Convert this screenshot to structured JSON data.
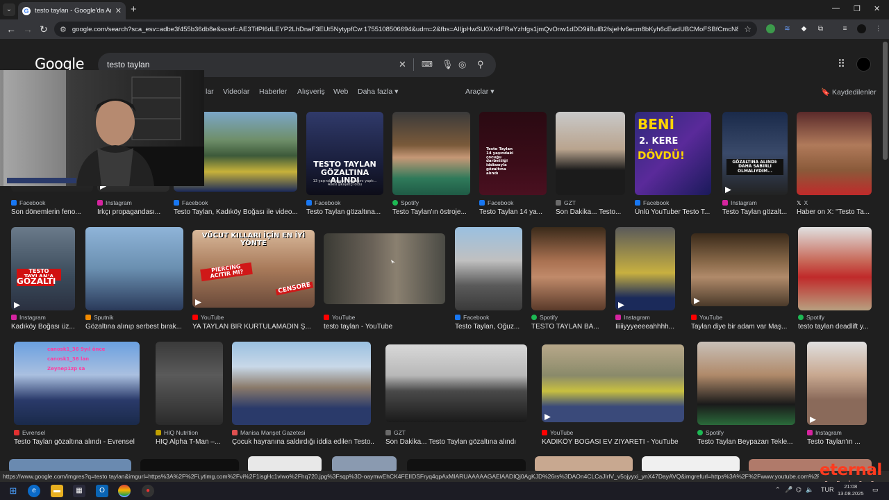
{
  "browser": {
    "tab_title": "testo taylan - Google'da Ara",
    "url": "google.com/search?sca_esv=adbe3f455b36db8e&sxsrf=AE3TifPl6dLEYP2LhDnaF3EUt5NytypfCw:1755108506694&udm=2&fbs=AIIjpHwSU0Xn4FRaYzhfgs1jmQvOnw1dDD9iiBulB2fsjeHv6ecm8bKyh6cEwdUBCMoFSBfCmcN8r0zRavg..."
  },
  "google": {
    "logo": "Google",
    "query": "testo taylan",
    "filters": {
      "partial": "lar",
      "videos": "Videolar",
      "news": "Haberler",
      "shopping": "Alışveriş",
      "web": "Web",
      "more": "Daha fazla",
      "tools": "Araçlar"
    },
    "saved": "Kaydedilenler"
  },
  "results": {
    "row1": [
      {
        "source": "Facebook",
        "caption": "Son dönemlerin feno..."
      },
      {
        "source": "Instagram",
        "caption": "Irkçı propagandası..."
      },
      {
        "source": "Facebook",
        "caption": "Testo Taylan, Kadıköy Boğası ile video..."
      },
      {
        "source": "Facebook",
        "caption": "Testo Taylan gözaltına..."
      },
      {
        "source": "Spotify",
        "caption": "Testo Taylan'ın östroje..."
      },
      {
        "source": "Facebook",
        "caption": "Testo Taylan 14 ya..."
      },
      {
        "source": "GZT",
        "caption": "Son Dakika... Testo..."
      },
      {
        "source": "Facebook",
        "caption": "Ünlü YouTuber Testo T..."
      },
      {
        "source": "Instagram",
        "caption": "Testo Taylan gözalt..."
      },
      {
        "source": "X",
        "caption": "Haber on X: \"Testo Ta..."
      }
    ],
    "row2": [
      {
        "source": "Instagram",
        "caption": "Kadıköy Boğası üz..."
      },
      {
        "source": "Sputnik",
        "caption": "Gözaltına alınıp serbest bırak..."
      },
      {
        "source": "YouTube",
        "caption": "YA TAYLAN BİR KURTULAMADIN Ş..."
      },
      {
        "source": "YouTube",
        "caption": "testo taylan - YouTube"
      },
      {
        "source": "Facebook",
        "caption": "Testo Taylan, Oğuz..."
      },
      {
        "source": "Spotify",
        "caption": "TESTO TAYLAN BA..."
      },
      {
        "source": "Instagram",
        "caption": "İiiiiyyyeeeeahhhh..."
      },
      {
        "source": "YouTube",
        "caption": "Taylan diye bir adam var Maş..."
      },
      {
        "source": "Spotify",
        "caption": "testo taylan deadlift y..."
      }
    ],
    "row3": [
      {
        "source": "Evrensel",
        "caption": "Testo Taylan gözaltına alındı - Evrensel"
      },
      {
        "source": "HIQ Nutrition",
        "caption": "HIQ Alpha T-Man –..."
      },
      {
        "source": "Manisa Manşet Gazetesi",
        "caption": "Çocuk hayranına saldırdığı iddia edilen Testo..."
      },
      {
        "source": "GZT",
        "caption": "Son Dakika... Testo Taylan gözaltına alındı"
      },
      {
        "source": "YouTube",
        "caption": "KADIKÖY BOĞASI EV ZİYARETİ - YouTube"
      },
      {
        "source": "Spotify",
        "caption": "Testo Taylan Beypazarı Tekle..."
      },
      {
        "source": "Instagram",
        "caption": "Testo Taylan'ın ..."
      }
    ]
  },
  "thumb_text": {
    "gozaltina": "TESTO TAYLAN GÖZALTINA ALINDI",
    "gozaltina_sub": "13 yaşındaki çocuk hayranını yaptı... Ailesi şikayetçi oldu",
    "beni": "BENİ",
    "kere": "2. KERE",
    "dovdu": "DÖVDÜ!",
    "testo14": "Testo Taylan 14 yaşındaki çocuğu darbettiği iddiasıyla gözaltına alındı",
    "sabirli": "GÖZALTINA ALINDI: DAHA SABIRLI OLMALIYDIM...",
    "ozalti_a": "TESTO TAYLAN'A",
    "ozalti_b": "GÖZALTI",
    "vucut": "VÜCUT KILLARI İÇİN EN İYİ YÖNTE",
    "piercing": "PIERCING ACITIR MI?",
    "censored": "CENSORE",
    "comments": [
      "canosk1_36 9yıl önce",
      "canosk1_36 lan",
      "Zeynep1zp sa"
    ]
  },
  "statusbar": {
    "url": "https://www.google.com/imgres?q=testo taylan&imgurl=https%3A%2F%2Fi.ytimg.com%2Fvi%2F1isgHc1viwo%2Fhq720.jpg%3Fsqp%3D-oaymwEhCK4FEIIDSFryq4qpAxMIARUAAAAAGAElAADIQj0AgKJD%26rs%3DAOn4CLCaJIrlV_v5ojyyxi_ynX47DayAVQ&imgrefurl=https%3A%2F%2Fwww.youtube.com%2F%40testotaylan&docid=OnP"
  },
  "watermark": {
    "brand": "eternal",
    "sub": "e p i c o m"
  },
  "taskbar": {
    "lang": "TUR",
    "time": "21:08",
    "date": "13.08.2025"
  },
  "colors": {
    "page_bg": "#1f1f1f",
    "searchbox": "#303134",
    "accent_red": "#ff3b1f"
  }
}
